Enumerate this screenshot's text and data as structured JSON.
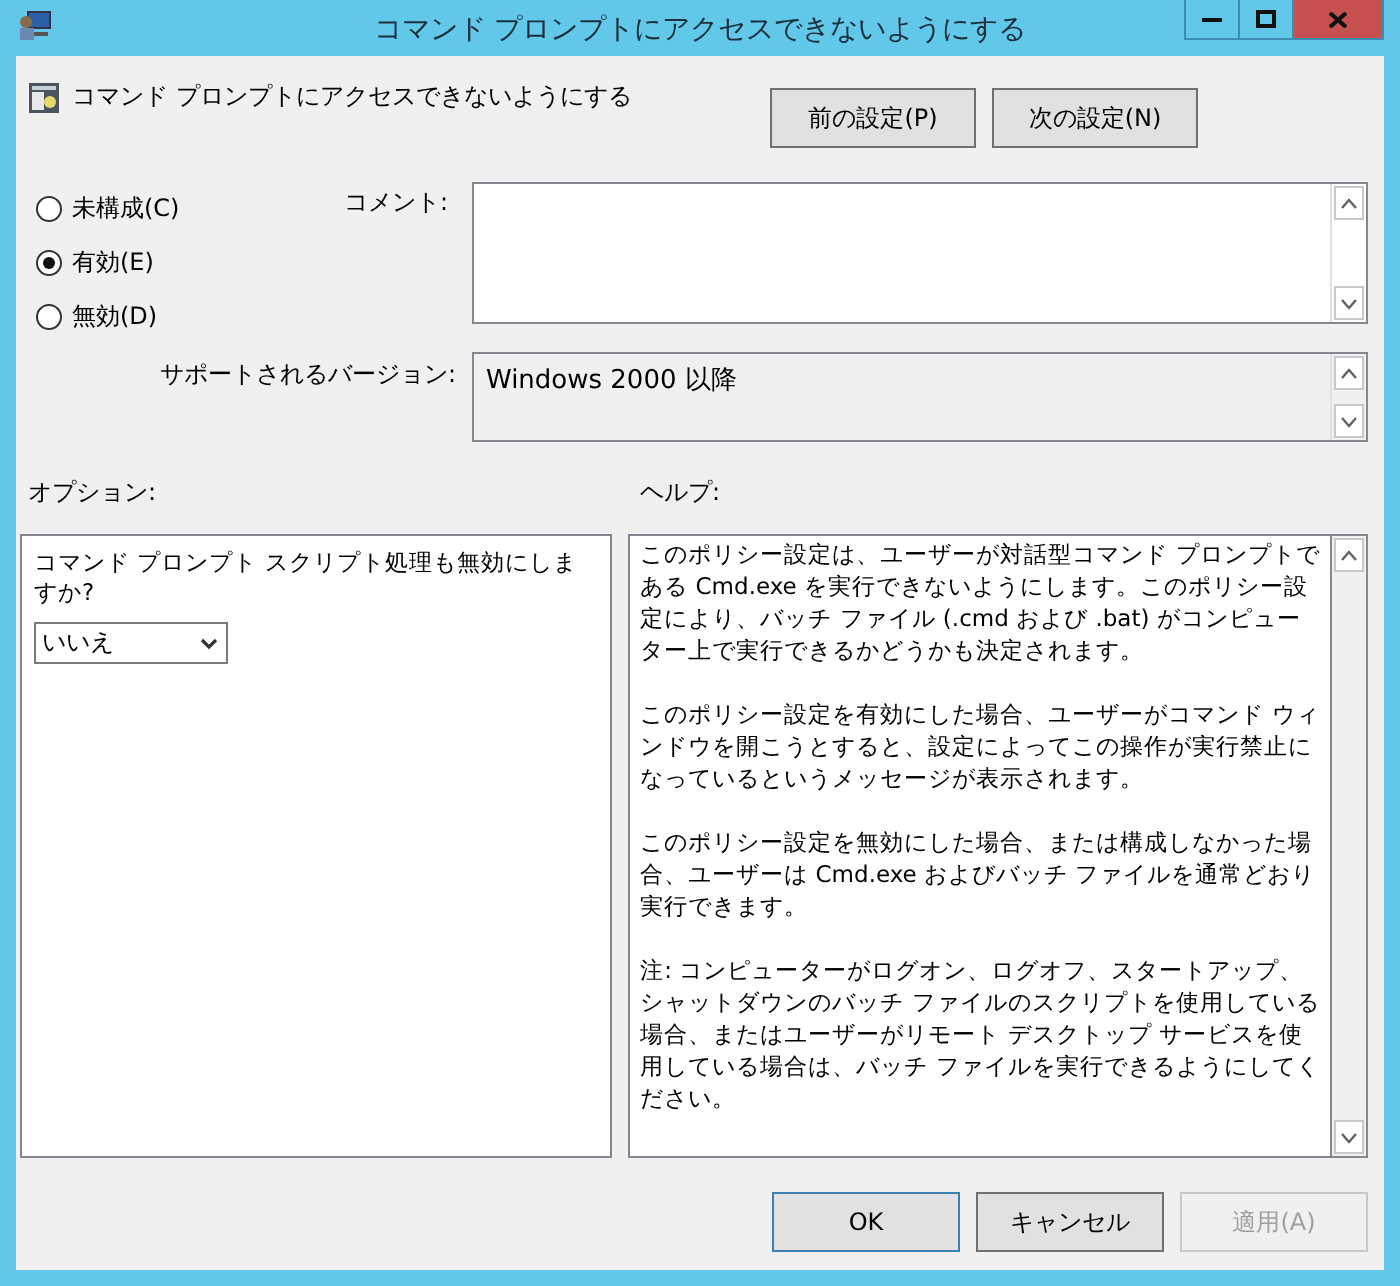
{
  "window": {
    "title": "コマンド プロンプトにアクセスできないようにする"
  },
  "policy_title": "コマンド プロンプトにアクセスできないようにする",
  "nav_buttons": [
    {
      "label": "前の設定(P)"
    },
    {
      "label": "次の設定(N)"
    }
  ],
  "state_options": [
    {
      "label": "未構成(C)",
      "selected": false
    },
    {
      "label": "有効(E)",
      "selected": true
    },
    {
      "label": "無効(D)",
      "selected": false
    }
  ],
  "comment": {
    "label": "コメント:"
  },
  "supported": {
    "label": "サポートされるバージョン:",
    "value": "Windows 2000 以降"
  },
  "options": {
    "label": "オプション:",
    "prompt": "コマンド プロンプト スクリプト処理も無効にしますか?",
    "dropdown": {
      "value": "いいえ"
    }
  },
  "help": {
    "label": "ヘルプ:",
    "paragraphs": [
      "このポリシー設定は、ユーザーが対話型コマンド プロンプトである Cmd.exe を実行できないようにします。このポリシー設定により、バッチ ファイル (.cmd および .bat) がコンピューター上で実行できるかどうかも決定されます。",
      "このポリシー設定を有効にした場合、ユーザーがコマンド ウィンドウを開こうとすると、設定によってこの操作が実行禁止になっているというメッセージが表示されます。",
      "このポリシー設定を無効にした場合、または構成しなかった場合、ユーザーは Cmd.exe およびバッチ ファイルを通常どおり実行できます。",
      "注: コンピューターがログオン、ログオフ、スタートアップ、シャットダウンのバッチ ファイルのスクリプトを使用している場合、またはユーザーがリモート デスクトップ サービスを使用している場合は、バッチ ファイルを実行できるようにしてください。"
    ]
  },
  "buttons": [
    {
      "label": "OK",
      "default": true,
      "disabled": false
    },
    {
      "label": "キャンセル",
      "default": false,
      "disabled": false
    },
    {
      "label": "適用(A)",
      "default": false,
      "disabled": true
    }
  ]
}
